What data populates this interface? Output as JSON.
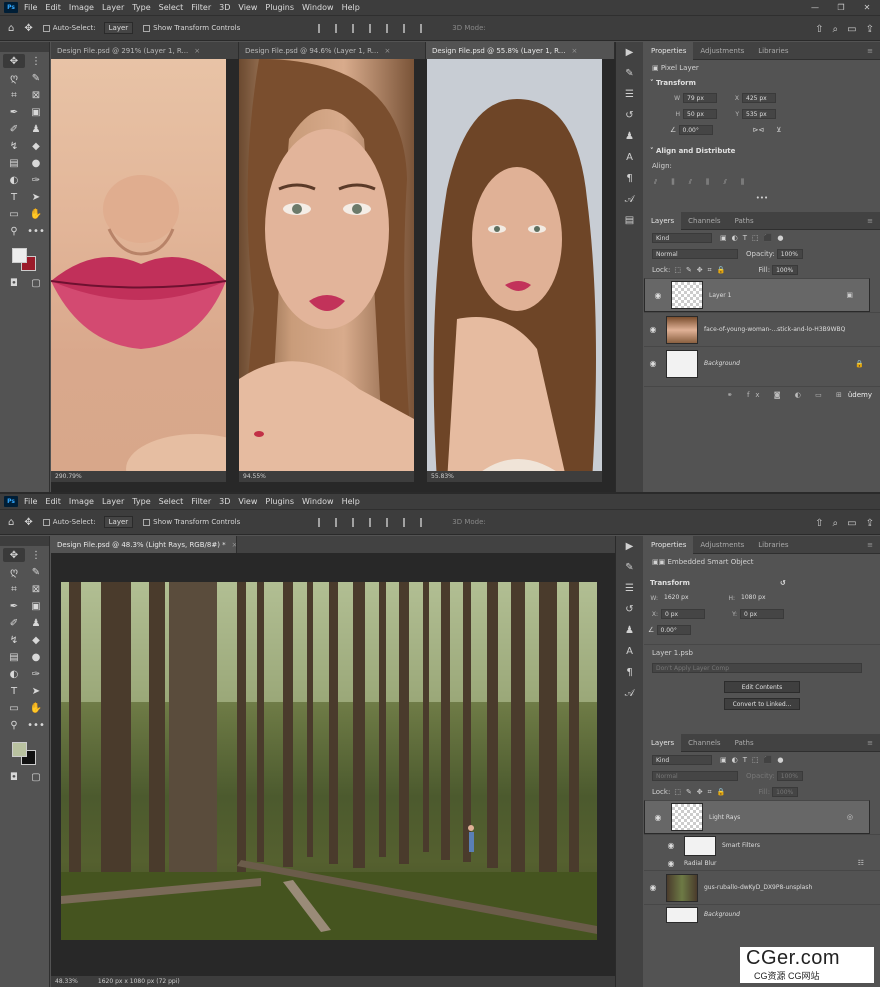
{
  "menu": [
    "File",
    "Edit",
    "Image",
    "Layer",
    "Type",
    "Select",
    "Filter",
    "3D",
    "View",
    "Plugins",
    "Window",
    "Help"
  ],
  "menu_bottom": [
    "File",
    "Edit",
    "Image",
    "Layer",
    "Type",
    "Select",
    "Filter",
    "3D",
    "View",
    "Plugins",
    "Window",
    "Help"
  ],
  "app_icon": "Ps",
  "options": {
    "auto_select": "Auto-Select:",
    "layer_select": "Layer",
    "show_transform": "Show Transform Controls",
    "mode_3d": "3D Mode:"
  },
  "top": {
    "tabs": [
      "Design File.psd @ 291% (Layer 1, R...",
      "Design File.psd @ 94.6% (Layer 1, R...",
      "Design File.psd @ 55.8% (Layer 1, R..."
    ],
    "zooms": [
      "290.79%",
      "94.55%",
      "55.83%"
    ],
    "properties": {
      "tabs": [
        "Properties",
        "Adjustments",
        "Libraries"
      ],
      "kind": "Pixel Layer",
      "transform_title": "Transform",
      "w": "79 px",
      "x": "425 px",
      "h": "50 px",
      "y": "535 px",
      "angle": "0.00°",
      "align_title": "Align and Distribute",
      "align_label": "Align:"
    },
    "layers": {
      "tabs": [
        "Layers",
        "Channels",
        "Paths"
      ],
      "filter": "Kind",
      "blend": "Normal",
      "opacity_label": "Opacity:",
      "opacity": "100%",
      "lock_label": "Lock:",
      "fill_label": "Fill:",
      "fill": "100%",
      "items": [
        "Layer 1",
        "face-of-young-woman-...stick-and-lo-H3B9WBQ",
        "Background"
      ]
    }
  },
  "bottom": {
    "tab": "Design File.psd @ 48.3% (Light Rays, RGB/8#) *",
    "zoom": "48.33%",
    "doc_size": "1620 px x 1080 px (72 ppi)",
    "properties": {
      "tabs": [
        "Properties",
        "Adjustments",
        "Libraries"
      ],
      "kind": "Embedded Smart Object",
      "transform_title": "Transform",
      "w": "1620 px",
      "h": "1080 px",
      "x": "0 px",
      "y": "0 px",
      "angle": "0.00°",
      "file": "Layer 1.psb",
      "comp": "Don't Apply Layer Comp",
      "edit_btn": "Edit Contents",
      "convert_btn": "Convert to Linked..."
    },
    "layers": {
      "tabs": [
        "Layers",
        "Channels",
        "Paths"
      ],
      "filter": "Kind",
      "blend": "Normal",
      "opacity_label": "Opacity:",
      "opacity": "100%",
      "lock_label": "Lock:",
      "fill_label": "Fill:",
      "fill": "100%",
      "items": [
        "Light Rays",
        "Smart Filters",
        "Radial Blur",
        "gus-ruballo-dwKyD_DX9P8-unsplash",
        "Background"
      ]
    }
  },
  "watermark": {
    "big": "CGer.com",
    "small": "CG资源 CG网站"
  },
  "udemy": "ûdemy",
  "colors": {
    "accent": "#31a8ff",
    "fg_top": "#ededed",
    "bg_top": "#9b1b2a",
    "fg_bottom": "#b9c2a0",
    "bg_bottom": "#111111"
  }
}
